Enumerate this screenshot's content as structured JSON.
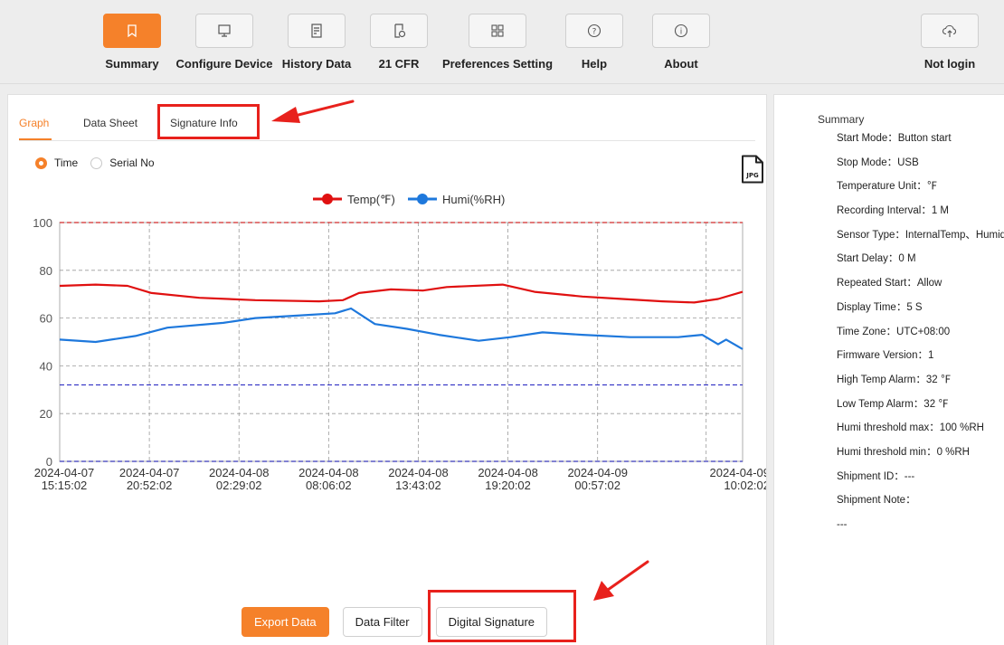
{
  "toolbar": {
    "items": [
      {
        "label": "Summary",
        "icon": "bookmark-icon",
        "active": true
      },
      {
        "label": "Configure Device",
        "icon": "monitor-icon"
      },
      {
        "label": "History Data",
        "icon": "history-document-icon"
      },
      {
        "label": "21 CFR",
        "icon": "document-clock-icon"
      },
      {
        "label": "Preferences Setting",
        "icon": "grid-icon"
      },
      {
        "label": "Help",
        "icon": "question-icon"
      },
      {
        "label": "About",
        "icon": "info-icon"
      }
    ],
    "login": {
      "label": "Not login",
      "icon": "cloud-upload-icon"
    }
  },
  "tabs": [
    "Graph",
    "Data Sheet",
    "Signature Info"
  ],
  "axis_mode": {
    "options": [
      "Time",
      "Serial No"
    ],
    "selected": "Time"
  },
  "export_icon_label": "JPG",
  "accent_color": "#f5812a",
  "annotation_color": "#e8211c",
  "buttons": {
    "export": "Export Data",
    "filter": "Data Filter",
    "signature": "Digital Signature"
  },
  "chart_data": {
    "type": "line",
    "ylim": [
      0,
      100
    ],
    "yticks": [
      0,
      20,
      40,
      60,
      80,
      100
    ],
    "x_ticks": [
      {
        "date": "2024-04-07",
        "time": "15:15:02"
      },
      {
        "date": "2024-04-07",
        "time": "20:52:02"
      },
      {
        "date": "2024-04-08",
        "time": "02:29:02"
      },
      {
        "date": "2024-04-08",
        "time": "08:06:02"
      },
      {
        "date": "2024-04-08",
        "time": "13:43:02"
      },
      {
        "date": "2024-04-08",
        "time": "19:20:02"
      },
      {
        "date": "2024-04-09",
        "time": "00:57:02"
      },
      {
        "date": "2024-04-09",
        "time": "10:02:02"
      }
    ],
    "grid": true,
    "legend_position": "top-center",
    "series": [
      {
        "name": "Temp(℉)",
        "color": "#e01010",
        "x": [
          "2024-04-07 15:15",
          "2024-04-07 17:30",
          "2024-04-07 19:30",
          "2024-04-07 21:00",
          "2024-04-08 00:00",
          "2024-04-08 03:30",
          "2024-04-08 07:30",
          "2024-04-08 09:00",
          "2024-04-08 10:00",
          "2024-04-08 12:00",
          "2024-04-08 14:00",
          "2024-04-08 15:30",
          "2024-04-08 19:00",
          "2024-04-08 21:00",
          "2024-04-09 00:00",
          "2024-04-09 02:30",
          "2024-04-09 05:00",
          "2024-04-09 07:00",
          "2024-04-09 08:30",
          "2024-04-09 10:02"
        ],
        "values": [
          73.5,
          74,
          73.5,
          70.5,
          68.5,
          67.5,
          67,
          67.5,
          70.5,
          72,
          71.5,
          73,
          74,
          71,
          69,
          68,
          67,
          66.5,
          68,
          71
        ]
      },
      {
        "name": "Humi(%RH)",
        "color": "#1e78dc",
        "x": [
          "2024-04-07 15:15",
          "2024-04-07 17:30",
          "2024-04-07 20:00",
          "2024-04-07 22:00",
          "2024-04-08 01:30",
          "2024-04-08 03:30",
          "2024-04-08 06:00",
          "2024-04-08 08:30",
          "2024-04-08 09:30",
          "2024-04-08 11:00",
          "2024-04-08 13:00",
          "2024-04-08 15:00",
          "2024-04-08 17:30",
          "2024-04-08 19:30",
          "2024-04-08 21:30",
          "2024-04-09 00:00",
          "2024-04-09 03:00",
          "2024-04-09 06:00",
          "2024-04-09 07:30",
          "2024-04-09 08:30",
          "2024-04-09 09:00",
          "2024-04-09 10:02"
        ],
        "values": [
          51,
          50,
          52.5,
          56,
          58,
          60,
          61,
          62,
          64,
          57.5,
          55.5,
          53,
          50.5,
          52,
          54,
          53,
          52,
          52,
          53,
          49,
          51,
          47
        ]
      },
      {
        "name": "High Temp Alarm",
        "color": "#e01010",
        "dashed": true,
        "x": [
          "2024-04-07 15:15",
          "2024-04-09 10:02"
        ],
        "values": [
          100,
          100
        ]
      },
      {
        "name": "Low Temp Alarm",
        "color": "#2020c0",
        "dashed": true,
        "x": [
          "2024-04-07 15:15",
          "2024-04-09 10:02"
        ],
        "values": [
          32,
          32
        ]
      },
      {
        "name": "Humi threshold min",
        "color": "#2020c0",
        "dashed": true,
        "x": [
          "2024-04-07 15:15",
          "2024-04-09 10:02"
        ],
        "values": [
          0,
          0
        ]
      }
    ]
  },
  "summary": {
    "title": "Summary",
    "items": [
      "Start Mode：Button start",
      "Stop Mode：USB",
      "Temperature Unit：℉",
      "Recording Interval：1 M",
      "Sensor Type：InternalTemp、Humidity",
      "Start Delay：0 M",
      "Repeated Start：Allow",
      "Display Time：5 S",
      "Time Zone：UTC+08:00",
      "Firmware Version：1",
      "High Temp Alarm：32 ℉",
      "Low Temp Alarm：32 ℉",
      "Humi threshold max：100 %RH",
      "Humi threshold min：0 %RH",
      "Shipment ID：---",
      "Shipment Note：",
      "---"
    ]
  }
}
